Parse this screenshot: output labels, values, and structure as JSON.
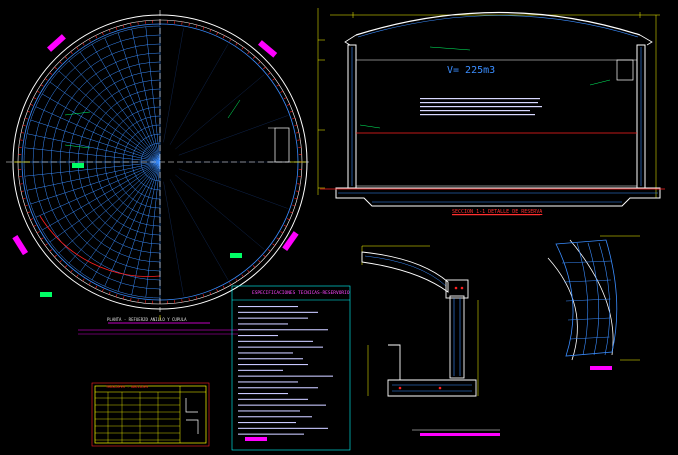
{
  "drawing": {
    "volume_label": "V= 225m3",
    "section_title": "SECCION 1-1   DETALLE DE RESERVA",
    "plan_title": "PLANTA - REFUERZO ANILLO Y CUPULA",
    "specs_title": "ESPECIFICACIONES TECNICAS-RESERVORIO",
    "table_title": "TRASLAPES - ANCLAJES"
  },
  "colors": {
    "background": "#000000",
    "mesh": "#3a8dff",
    "outline": "#ffffff",
    "highlight": "#ff00ff",
    "dimension": "#ffff00",
    "accent": "#ff2020",
    "label": "#00ff66",
    "annotation": "#00ffff"
  }
}
